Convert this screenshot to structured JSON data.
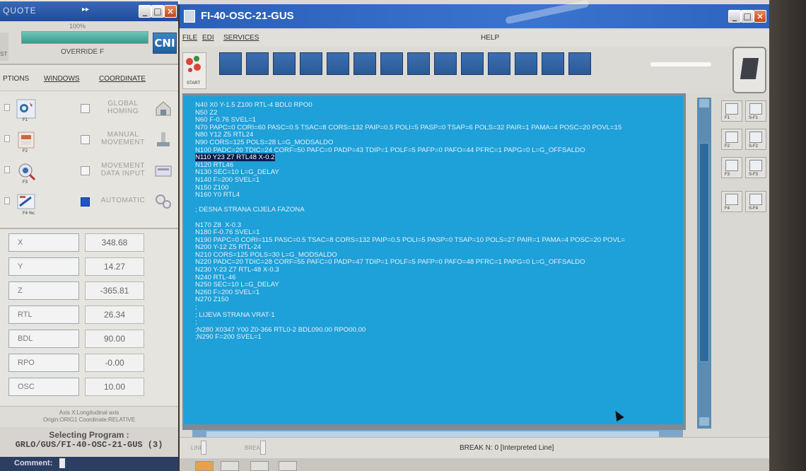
{
  "left_window": {
    "title": "QUOTE",
    "title_dots": "▸▸",
    "override": {
      "percent_label": "100%",
      "level": 1.0,
      "label": "OVERRIDE F",
      "left_tag": "ST"
    },
    "logo": "CNI",
    "menu": {
      "options": "PTIONS",
      "windows": "WINDOWS",
      "coordinate": "COORDINATE"
    },
    "modes": [
      {
        "fkey": "F1",
        "label": "GLOBAL HOMING",
        "checked": false
      },
      {
        "fkey": "F2",
        "label": "MANUAL MOVEMENT",
        "checked": false
      },
      {
        "fkey": "F3",
        "label": "MOVEMENT DATA INPUT",
        "checked": false
      },
      {
        "fkey": "F4 %c",
        "label": "AUTOMATIC",
        "checked": true
      }
    ],
    "coordinates": [
      {
        "name": "X",
        "value": "348.68"
      },
      {
        "name": "Y",
        "value": "14.27"
      },
      {
        "name": "Z",
        "value": "-365.81"
      },
      {
        "name": "RTL",
        "value": "26.34"
      },
      {
        "name": "BDL",
        "value": "90.00"
      },
      {
        "name": "RPO",
        "value": "-0.00"
      },
      {
        "name": "OSC",
        "value": "10.00"
      }
    ],
    "axis_info_1": "Axis X:Longitudinal axis",
    "axis_info_2": "Origin:ORIG1  Coordinate:RELATIVE",
    "selecting_label": "Selecting Program :",
    "program_path": "GRLO/GUS/FI-40-OSC-21-GUS (3)",
    "comment_label": "Comment:"
  },
  "main_window": {
    "title": "FI-40-OSC-21-GUS",
    "menu": {
      "file": "FILE",
      "edit": "EDI",
      "services": "SERVICES",
      "help": "HELP"
    },
    "start_label": "START",
    "program_lines": [
      "N40 X0 Y-1.5 Z100 RTL-4 BDL0 RPO0",
      "N50 Z2",
      "N60 F-0.76 SVEL=1",
      "N70 PAPC=0 CORI=60 PASC=0.5 TSAC=8 CORS=132 PAIP=0.5 POLI=5 PASP=0 TSAP=6 POLS=32 PAIR=1 PAMA=4 POSC=20 POVL=15",
      "N80 Y12 Z5 RTL24",
      "N90 CORS=125 POLS=28 L=G_MODSALDO",
      "N100 PADC=20 TDIC=24 CORF=50 PAFC=0 PADP=43 TDIP=1 POLF=5 PAFP=0 PAFO=44 PFRC=1 PAPG=0 L=G_OFFSALDO",
      "N110 Y23 Z7 RTL48 X-0.2",
      "N120 RTL46",
      "N130 SEC=10 L=G_DELAY",
      "N140 F=200 SVEL=1",
      "N150 Z100",
      "N160 Y0 RTL4",
      "",
      "; DESNA STRANA CIJELA FAZONA",
      "",
      "N170 Z8  X-0.3",
      "N180 F-0.76 SVEL=1",
      "N190 PAPC=0 CORI=115 PASC=0.5 TSAC=8 CORS=132 PAIP=0.5 POLI=5 PASP=0 TSAP=10 POLS=27 PAIR=1 PAMA=4 POSC=20 POVL=",
      "N200 Y-12 Z5 RTL-24",
      "N210 CORS=125 POLS=30 L=G_MODSALDO",
      "N220 PADC=20 TDIC=28 CORF=55 PAFC=0 PADP=47 TDIP=1 POLF=5 PAFP=0 PAFO=48 PFRC=1 PAPG=0 L=G_OFFSALDO",
      "N230 Y-23 Z7 RTL-48 X-0.3",
      "N240 RTL-46",
      "N250 SEC=10 L=G_DELAY",
      "N260 F=200 SVEL=1",
      "N270 Z150",
      ";",
      "; LIJEVA STRANA VRAT-1",
      ";",
      ";N280 X0347 Y00 Z0-366 RTL0-2 BDL090.00 RPO00.00",
      ";N290 F=200 SVEL=1"
    ],
    "selected_line_index": 7,
    "function_keys": [
      "F1",
      "S-F1",
      "F2",
      "S-F2",
      "F3",
      "S-F3",
      "F4",
      "S-F4"
    ],
    "status": {
      "line_label": "LINE",
      "break_label": "BREAK",
      "break_info": "BREAK N: 0  [Interpreted Line]"
    }
  }
}
